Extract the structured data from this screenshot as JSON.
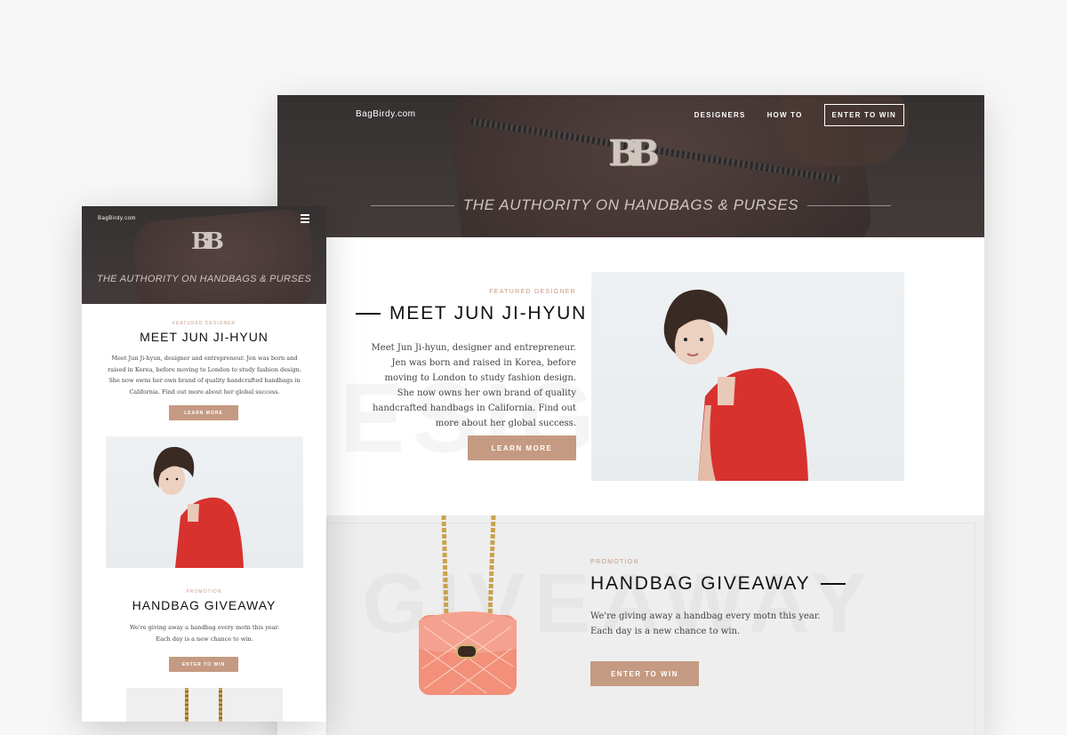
{
  "desktop": {
    "brand": "BagBirdy.com",
    "nav": {
      "designers": "DESIGNERS",
      "howto": "HOW TO",
      "cta": "ENTER TO WIN"
    },
    "logo": "BB",
    "tagline": "THE AUTHORITY ON HANDBAGS & PURSES",
    "featured": {
      "label": "FEATURED DESIGNER",
      "title": "MEET JUN JI-HYUN",
      "text": "Meet Jun Ji-hyun, designer and entrepreneur. Jen was born and raised in Korea, before moving to London to study fashion design. She now owns her own brand of quality handcrafted handbags in California. Find out more about her global success.",
      "button": "LEARN MORE"
    },
    "giveaway": {
      "label": "PROMOTION",
      "title": "HANDBAG GIVEAWAY",
      "text_line1": "We're giving away a handbag every motn this year.",
      "text_line2": "Each day is a new chance to win.",
      "button": "ENTER TO WIN"
    }
  },
  "mobile": {
    "brand": "BagBirdy.com",
    "logo": "BB",
    "tagline": "THE AUTHORITY ON HANDBAGS & PURSES",
    "featured": {
      "label": "FEATURED DESIGNER",
      "title": "MEET JUN JI-HYUN",
      "text": "Meet Jun Ji-hyun, designer and entrepreneur. Jen was born and raised in Korea, before moving to London to study fashion design. She now owns her own brand of quality handcrafted handbags in California. Find out more about her global success.",
      "button": "LEARN MORE"
    },
    "giveaway": {
      "label": "PROMOTION",
      "title": "HANDBAG GIVEAWAY",
      "text_line1": "We're giving away a handbag every motn this year.",
      "text_line2": "Each day is a new chance to win.",
      "button": "ENTER TO WIN"
    }
  },
  "icons": {
    "menu": "hamburger-menu-icon"
  },
  "colors": {
    "accent": "#c59a82",
    "page_bg": "#f7f7f7",
    "hero_dark": "#3e3a39",
    "dress_red": "#d7322e",
    "bag_pink": "#f2907a"
  }
}
